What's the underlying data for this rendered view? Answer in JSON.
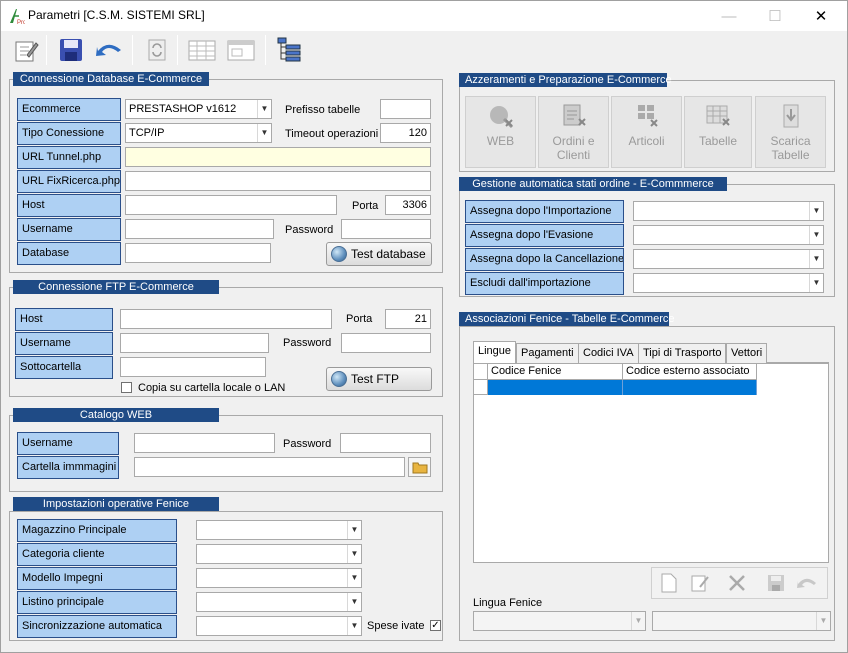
{
  "window": {
    "title": "Parametri [C.S.M. SISTEMI SRL]",
    "controls": {
      "minimize": "—",
      "maximize": "☐",
      "close": "✕"
    }
  },
  "toolbar": {
    "icons": [
      "edit-icon",
      "save-icon",
      "undo-icon",
      "refresh-icon",
      "table-icon",
      "form-icon",
      "tree-icon"
    ]
  },
  "db_section": {
    "title": "Connessione Database E-Commerce",
    "ecommerce_label": "Ecommerce",
    "ecommerce_value": "PRESTASHOP v1612",
    "prefix_label": "Prefisso tabelle",
    "prefix_value": "",
    "conn_type_label": "Tipo Conessione",
    "conn_type_value": "TCP/IP",
    "timeout_label": "Timeout operazioni",
    "timeout_value": "120",
    "url_tunnel_label": "URL Tunnel.php",
    "url_tunnel_value": "",
    "url_fix_label": "URL FixRicerca.php",
    "url_fix_value": "",
    "host_label": "Host",
    "host_value": "",
    "port_label": "Porta",
    "port_value": "3306",
    "user_label": "Username",
    "user_value": "",
    "pass_label": "Password",
    "pass_value": "",
    "db_label": "Database",
    "db_value": "",
    "test_button": "Test database"
  },
  "ftp_section": {
    "title": "Connessione FTP E-Commerce",
    "host_label": "Host",
    "host_value": "",
    "port_label": "Porta",
    "port_value": "21",
    "user_label": "Username",
    "user_value": "",
    "pass_label": "Password",
    "pass_value": "",
    "subfolder_label": "Sottocartella",
    "subfolder_value": "",
    "copy_label": "Copia su cartella locale o LAN",
    "copy_checked": false,
    "test_button": "Test  FTP"
  },
  "catalog_section": {
    "title": "Catalogo WEB",
    "user_label": "Username",
    "user_value": "",
    "pass_label": "Password",
    "pass_value": "",
    "images_label": "Cartella immmagini",
    "images_value": ""
  },
  "fenice_section": {
    "title": "Impostazioni operative Fenice",
    "rows": [
      {
        "label": "Magazzino Principale",
        "value": ""
      },
      {
        "label": "Categoria cliente",
        "value": ""
      },
      {
        "label": "Modello Impegni",
        "value": ""
      },
      {
        "label": "Listino principale",
        "value": ""
      },
      {
        "label": "Sincronizzazione automatica",
        "value": ""
      }
    ],
    "spese_label": "Spese ivate",
    "spese_checked": true
  },
  "reset_section": {
    "title": "Azzeramenti e Preparazione E-Commerce",
    "buttons": [
      {
        "label": "WEB",
        "icon": "web-icon"
      },
      {
        "label": "Ordini e Clienti",
        "icon": "orders-icon"
      },
      {
        "label": "Articoli",
        "icon": "items-icon"
      },
      {
        "label": "Tabelle",
        "icon": "tables-icon"
      },
      {
        "label": "Scarica Tabelle",
        "icon": "download-tables-icon"
      }
    ]
  },
  "orders_section": {
    "title": "Gestione automatica stati ordine - E-Commmerce",
    "rows": [
      {
        "label": "Assegna dopo  l'Importazione",
        "value": ""
      },
      {
        "label": "Assegna dopo l'Evasione",
        "value": ""
      },
      {
        "label": "Assegna dopo la Cancellazione",
        "value": ""
      },
      {
        "label": "Escludi dall'importazione",
        "value": ""
      }
    ]
  },
  "assoc_section": {
    "title": "Associazioni Fenice - Tabelle E-Commerce",
    "tabs": [
      "Lingue",
      "Pagamenti",
      "Codici IVA",
      "Tipi di Trasporto",
      "Vettori"
    ],
    "active_tab": "Lingue",
    "columns": [
      "Codice Fenice",
      "Codice esterno associato"
    ],
    "lingua_label": "Lingua Fenice",
    "lingua_value": "",
    "lingua_value2": ""
  }
}
